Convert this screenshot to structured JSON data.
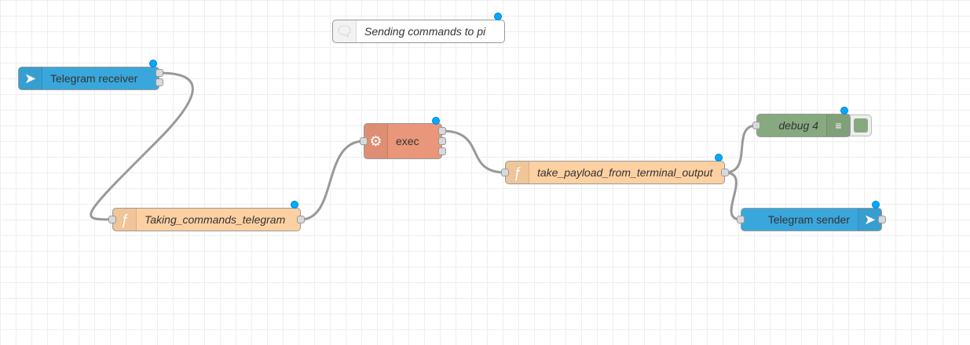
{
  "nodes": {
    "comment": {
      "label": "Sending commands to pi",
      "icon": "comment-icon"
    },
    "telegram_receiver": {
      "label": "Telegram receiver",
      "icon": "telegram-icon",
      "color": "#3aa7dc"
    },
    "taking_commands": {
      "label": "Taking_commands_telegram",
      "icon": "function-icon",
      "color": "#fdd0a2"
    },
    "exec": {
      "label": "exec",
      "icon": "gear-icon",
      "color": "#e9967a"
    },
    "take_payload": {
      "label": "take_payload_from_terminal_output",
      "icon": "function-icon",
      "color": "#fdd0a2"
    },
    "debug": {
      "label": "debug 4",
      "icon": "list-icon",
      "color": "#87a980"
    },
    "telegram_sender": {
      "label": "Telegram sender",
      "icon": "telegram-icon",
      "color": "#3aa7dc"
    }
  },
  "colors": {
    "wire": "#999999",
    "changed_dot": "#00a9ff"
  }
}
